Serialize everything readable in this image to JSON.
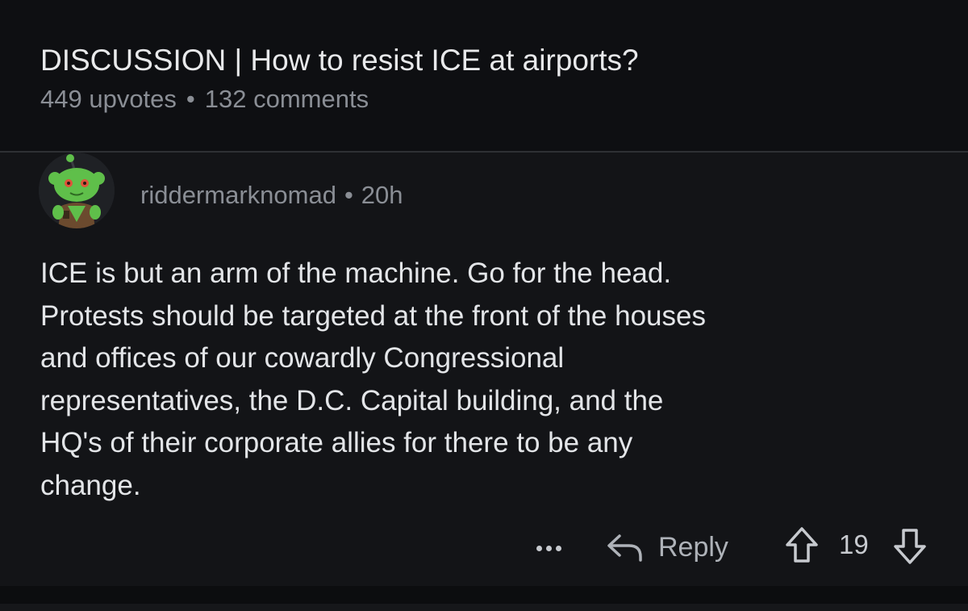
{
  "post": {
    "title": "DISCUSSION | How to resist ICE at airports?",
    "upvotes": "449 upvotes",
    "separator": "•",
    "comments": "132 comments"
  },
  "comment": {
    "author": "riddermarknomad",
    "separator": "•",
    "age": "20h",
    "avatar_icon": "snoo-avatar-icon",
    "body_lines": [
      "ICE is but an arm of the machine.  Go for the head.",
      "Protests should be targeted at the front of the houses",
      "and offices of our cowardly Congressional",
      "representatives, the D.C. Capital building, and the",
      "HQ's of their corporate allies for there to be any",
      "change."
    ],
    "actions": {
      "more_icon": "more-dots-icon",
      "reply_icon": "reply-arrow-icon",
      "reply_label": "Reply",
      "upvote_icon": "upvote-arrow-icon",
      "score": "19",
      "downvote_icon": "downvote-arrow-icon"
    }
  },
  "colors": {
    "background": "#101114",
    "comment_background": "#131417",
    "primary_text": "#e3e5e8",
    "secondary_text": "#8a8e95",
    "avatar_green": "#5fbf4a"
  }
}
